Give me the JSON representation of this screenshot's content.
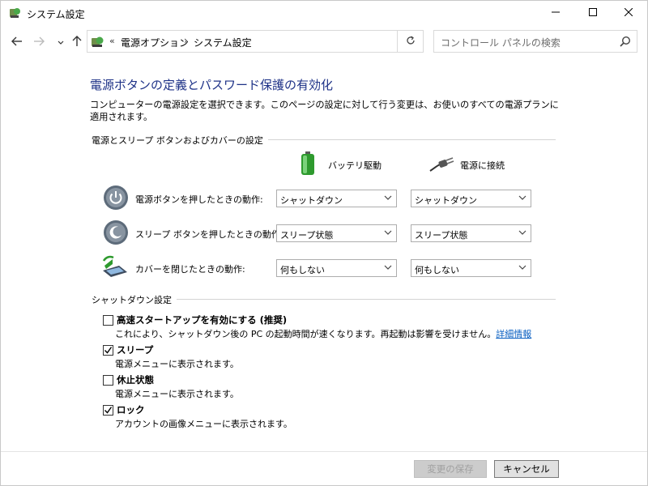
{
  "window": {
    "title": "システム設定",
    "controls": {
      "minimize": "minimize-icon",
      "maximize": "maximize-icon",
      "close": "close-icon"
    }
  },
  "address": {
    "overflow": "«",
    "separator": "›",
    "crumbs": [
      "電源オプション",
      "システム設定"
    ],
    "refresh_icon": "refresh-icon"
  },
  "search": {
    "placeholder": "コントロール パネルの検索"
  },
  "page": {
    "title": "電源ボタンの定義とパスワード保護の有効化",
    "intro": "コンピューターの電源設定を選択できます。このページの設定に対して行う変更は、お使いのすべての電源プランに適用されます。"
  },
  "power_section": {
    "title": "電源とスリープ ボタンおよびカバーの設定",
    "columns": {
      "battery": "バッテリ駆動",
      "plugged": "電源に接続"
    },
    "rows": [
      {
        "label": "電源ボタンを押したときの動作:",
        "battery": "シャットダウン",
        "plugged": "シャットダウン",
        "icon": "power-button-icon"
      },
      {
        "label": "スリープ ボタンを押したときの動作:",
        "battery": "スリープ状態",
        "plugged": "スリープ状態",
        "icon": "sleep-button-icon"
      },
      {
        "label": "カバーを閉じたときの動作:",
        "battery": "何もしない",
        "plugged": "何もしない",
        "icon": "laptop-lid-icon"
      }
    ]
  },
  "shutdown_section": {
    "title": "シャットダウン設定",
    "options": [
      {
        "label": "高速スタートアップを有効にする (推奨)",
        "desc": "これにより、シャットダウン後の PC の起動時間が速くなります。再起動は影響を受けません。",
        "link": "詳細情報",
        "checked": false
      },
      {
        "label": "スリープ",
        "desc": "電源メニューに表示されます。",
        "checked": true
      },
      {
        "label": "休止状態",
        "desc": "電源メニューに表示されます。",
        "checked": false
      },
      {
        "label": "ロック",
        "desc": "アカウントの画像メニューに表示されます。",
        "checked": true
      }
    ]
  },
  "buttons": {
    "save": "変更の保存",
    "cancel": "キャンセル"
  },
  "colors": {
    "title": "#1e3287",
    "link": "#0b60c2"
  }
}
